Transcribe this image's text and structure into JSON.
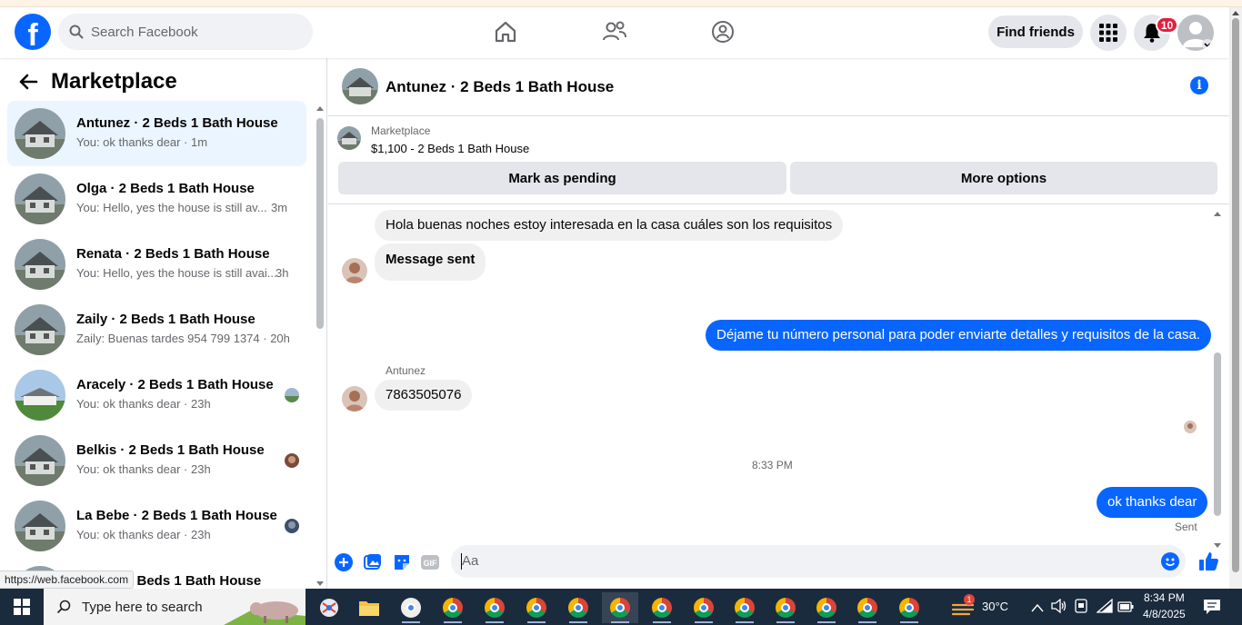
{
  "header": {
    "logo": "f",
    "search_placeholder": "Search Facebook",
    "find_friends_label": "Find friends",
    "notification_count": "10",
    "nav_icons": [
      "home-icon",
      "friends-icon",
      "groups-icon"
    ]
  },
  "sidebar": {
    "title": "Marketplace",
    "conversations": [
      {
        "name": "Antunez · 2 Beds 1 Bath House",
        "preview": "You: ok thanks dear · 1m",
        "active": true
      },
      {
        "name": "Olga · 2 Beds 1 Bath House",
        "preview": "You: Hello, yes the house is still av...",
        "time": "3m"
      },
      {
        "name": "Renata · 2 Beds 1 Bath House",
        "preview": "You: Hello, yes the house is still avai...",
        "time": "3h"
      },
      {
        "name": "Zaily · 2 Beds 1 Bath House",
        "preview": "Zaily: Buenas tardes 954 799 1374 · 20h"
      },
      {
        "name": "Aracely · 2 Beds 1 Bath House",
        "preview": "You: ok thanks dear · 23h"
      },
      {
        "name": "Belkis · 2 Beds 1 Bath House",
        "preview": "You: ok thanks dear · 23h"
      },
      {
        "name": "La Bebe · 2 Beds 1 Bath House",
        "preview": "You: ok thanks dear · 23h"
      },
      {
        "name": "2 Beds 1 Bath House",
        "preview": ""
      }
    ]
  },
  "status_url": "https://web.facebook.com",
  "chat": {
    "title": "Antunez · 2 Beds 1 Bath House",
    "marketplace_label": "Marketplace",
    "listing": "$1,100 - 2 Beds 1 Bath House",
    "mark_pending_label": "Mark as pending",
    "more_options_label": "More options",
    "messages": [
      {
        "text": "Hola buenas noches estoy interesada en la casa cuáles son los requisitos",
        "dir": "in"
      },
      {
        "text": "Message sent",
        "dir": "in"
      },
      {
        "text": "Déjame tu número personal para poder enviarte detalles y requisitos de la casa.",
        "dir": "out"
      },
      {
        "text": "7863505076",
        "dir": "in",
        "sender": "Antunez"
      },
      {
        "text": "ok thanks dear",
        "dir": "out"
      }
    ],
    "time_divider": "8:33 PM",
    "sent_status": "Sent",
    "composer_placeholder": "Aa"
  },
  "taskbar": {
    "search_placeholder": "Type here to search",
    "weather": "30°C",
    "weather_badge": "1",
    "time": "8:34 PM",
    "date": "4/8/2025"
  },
  "colors": {
    "brand": "#0866ff",
    "active_conv": "#ebf5ff",
    "notification": "#e41e3f"
  }
}
